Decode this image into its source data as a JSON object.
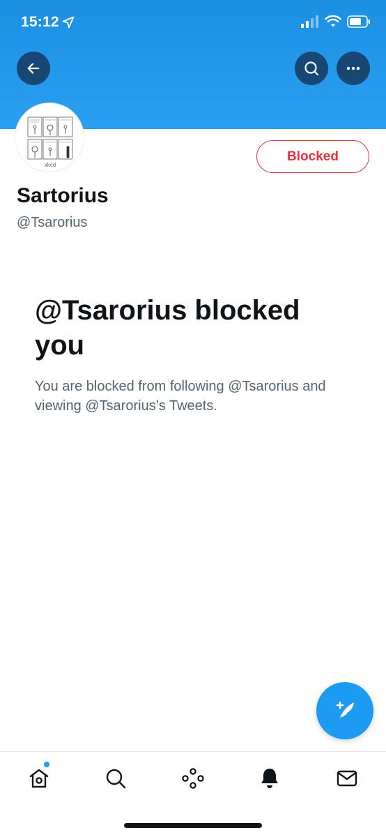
{
  "status_bar": {
    "time": "15:12"
  },
  "header": {
    "back_icon": "arrow-left-icon",
    "search_icon": "search-icon",
    "more_icon": "more-dots-icon"
  },
  "profile": {
    "display_name": "Sartorius",
    "handle": "@Tsarorius",
    "relationship_button_label": "Blocked",
    "avatar_caption": "xkcd"
  },
  "blocked_notice": {
    "title": "@Tsarorius blocked you",
    "description": "You are blocked from following @Tsarorius and viewing @Tsarorius’s Tweets."
  },
  "fab": {
    "icon": "compose-tweet-icon"
  },
  "tab_bar": {
    "items": [
      {
        "name": "home",
        "icon": "home-icon",
        "has_badge": true
      },
      {
        "name": "search",
        "icon": "search-icon"
      },
      {
        "name": "spaces",
        "icon": "spaces-icon"
      },
      {
        "name": "notifications",
        "icon": "bell-icon",
        "selected": true
      },
      {
        "name": "messages",
        "icon": "mail-icon"
      }
    ]
  },
  "colors": {
    "header_blue": "#1d9bf0",
    "blocked_red": "#e8333c",
    "text_primary": "#0f1419",
    "text_secondary": "#536471"
  }
}
